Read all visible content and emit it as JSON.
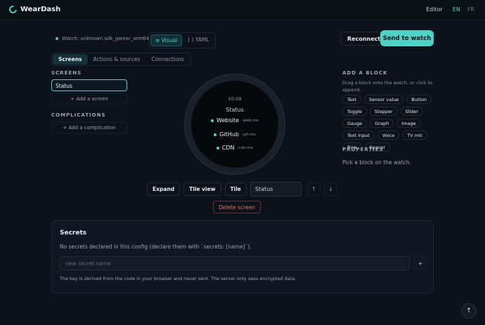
{
  "app": {
    "title": "WearDash"
  },
  "nav": {
    "editor": "Editor",
    "lang_en": "EN",
    "lang_fr": "FR"
  },
  "toolbar": {
    "watch_status": "Watch: unknown sdk_gwear_arm64",
    "mode_visual": "Visual",
    "mode_visual_icon": "≡",
    "mode_yaml": "YAML",
    "mode_yaml_icon": "( )",
    "reconnect": "Reconnect",
    "send": "Send to watch"
  },
  "tabs": [
    "Screens",
    "Actions & sources",
    "Connections"
  ],
  "screens": {
    "title": "SCREENS",
    "items": [
      "Status"
    ],
    "add": "+ Add a screen"
  },
  "complications": {
    "title": "COMPLICATIONS",
    "add": "+ Add a complication"
  },
  "watch": {
    "time": "10:09",
    "title": "Status",
    "rows": [
      {
        "label": "Website",
        "sub": "‹web›ms"
      },
      {
        "label": "GitHub",
        "sub": "‹git›ms"
      },
      {
        "label": "CDN",
        "sub": "‹cdn›ms"
      }
    ]
  },
  "controls": {
    "expand": "Expand",
    "tile_view": "Tile view",
    "tile": "Tile",
    "screen_name": "Status",
    "up": "↑",
    "down": "↓",
    "delete": "Delete screen"
  },
  "add_block": {
    "title": "ADD A BLOCK",
    "desc": "Drag a block onto the watch, or click to append.",
    "blocks": [
      "Text",
      "Sensor value",
      "Button",
      "Toggle",
      "Stepper",
      "Slider",
      "Gauge",
      "Graph",
      "Image",
      "Text input",
      "Voice",
      "TV mic",
      "Row",
      "Spacer"
    ]
  },
  "properties": {
    "title": "PROPERTIES",
    "empty": "Pick a block on the watch."
  },
  "secrets": {
    "title": "Secrets",
    "desc": "No secrets declared in this config (declare them with `secrets: [name]`).",
    "placeholder": "new secret name",
    "add": "+",
    "note": "The key is derived from the code in your browser and never sent. The server only sees encrypted data."
  },
  "fab": {
    "icon": "↑"
  },
  "colors": {
    "accent": "#4fd1c5",
    "danger": "#e0706a",
    "background": "#0d121a"
  }
}
